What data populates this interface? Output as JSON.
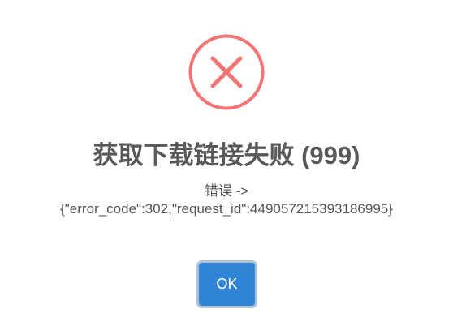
{
  "dialog": {
    "icon": "error-x-circle-icon",
    "title": "获取下载链接失败 (999)",
    "message_prefix": "错误 ->",
    "message_body": "{\"error_code\":302,\"request_id\":449057215393186995}",
    "ok_label": "OK"
  },
  "colors": {
    "error_icon": "#f27474",
    "title_text": "#595959",
    "body_text": "#545454",
    "confirm_button": "#3085d6"
  }
}
